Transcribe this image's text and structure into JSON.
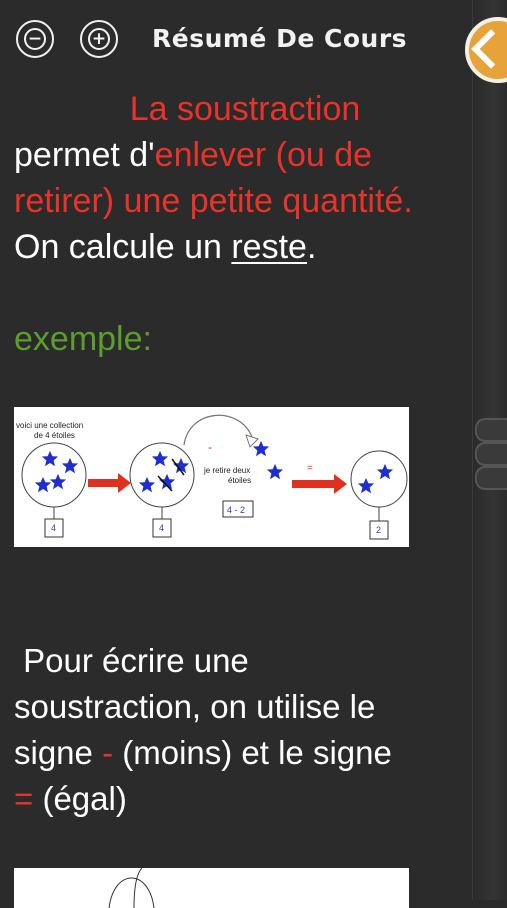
{
  "header": {
    "title": "Résumé De Cours",
    "zoom_out_icon": "minus-circle-icon",
    "zoom_in_icon": "plus-circle-icon",
    "next_icon": "chevron-left-icon"
  },
  "intro": {
    "line1": "La soustraction",
    "line2_pre": "permet d'",
    "line2_red": "enlever (ou  de",
    "line3_red": "retirer) une petite quantité.",
    "line4_pre": "On calcule un ",
    "line4_under": "reste",
    "line4_post": "."
  },
  "example_label": "exemple:",
  "diagram": {
    "caption_left": [
      "voici une collection",
      "de 4 étoiles"
    ],
    "minus_sign": "-",
    "caption_mid": [
      "je retire deux",
      "étoiles"
    ],
    "equals_sign": "=",
    "box_values": [
      "4",
      "4",
      "4 - 2",
      "2"
    ]
  },
  "rule": {
    "line1": " Pour écrire une",
    "line2": "soustraction, on utilise le",
    "line3_pre": "signe ",
    "line3_red": "-",
    "line3_post": " (moins) et le signe",
    "line4_red": "=",
    "line4_post": " (égal)"
  },
  "colors": {
    "background": "#2b2b2b",
    "red": "#e8322a",
    "green": "#5a9e2c",
    "star_blue": "#1f2ed0",
    "arrow_red": "#e0301e",
    "badge_orange": "#e8a23a"
  }
}
